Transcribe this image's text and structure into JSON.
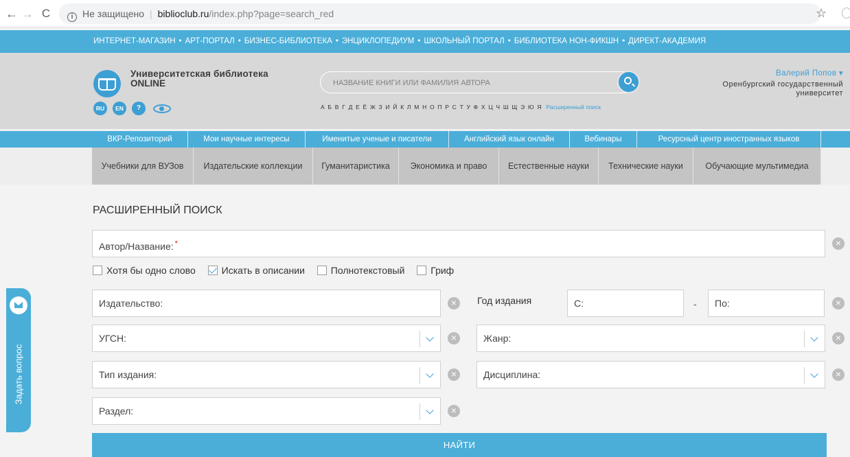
{
  "browser": {
    "insecure_label": "Не защищено",
    "url_host": "biblioclub.ru",
    "url_path": "/index.php?page=search_red"
  },
  "portals": [
    "ИНТЕРНЕТ-МАГАЗИН",
    "АРТ-ПОРТАЛ",
    "БИЗНЕС-БИБЛИОТЕКА",
    "ЭНЦИКЛОПЕДИУМ",
    "ШКОЛЬНЫЙ ПОРТАЛ",
    "БИБЛИОТЕКА НОН-ФИКШН",
    "ДИРЕКТ-АКАДЕМИЯ"
  ],
  "portal_separator": "•",
  "header": {
    "logo_title": "Университетская библиотека",
    "logo_sub": "ONLINE",
    "lang_ru": "RU",
    "lang_en": "EN",
    "help": "?",
    "search_placeholder": "НАЗВАНИЕ КНИГИ ИЛИ ФАМИЛИЯ АВТОРА",
    "alphabet": "А Б В Г Д Е Ё Ж З И Й К Л М Н О П Р С Т У Ф Х Ц Ч Ш Щ Э Ю Я",
    "advanced_link": "Расширенный поиск",
    "user_name": "Валерий Попов ▾",
    "user_org": "Оренбургский государственный университет"
  },
  "nav1": [
    "ВКР-Репозиторий",
    "Мои научные интересы",
    "Именитые ученые и писатели",
    "Английский язык онлайн",
    "Вебинары",
    "Ресурсный центр иностранных языков"
  ],
  "nav2": [
    "Учебники для ВУЗов",
    "Издательские коллекции",
    "Гуманитаристика",
    "Экономика и право",
    "Естественные науки",
    "Технические науки",
    "Обучающие мультимедиа"
  ],
  "form": {
    "title": "РАСШИРЕННЫЙ ПОИСК",
    "author_title_label": "Автор/Название:",
    "required_mark": "*",
    "checkboxes": [
      {
        "label": "Хотя бы одно слово",
        "checked": false
      },
      {
        "label": "Искать в описании",
        "checked": true
      },
      {
        "label": "Полнотекстовый",
        "checked": false
      },
      {
        "label": "Гриф",
        "checked": false
      }
    ],
    "publisher_label": "Издательство:",
    "year_label": "Год издания",
    "year_from": "С:",
    "year_dash": "-",
    "year_to": "По:",
    "ugsn_label": "УГСН:",
    "genre_label": "Жанр:",
    "edition_type_label": "Тип издания:",
    "discipline_label": "Дисциплина:",
    "section_label": "Раздел:",
    "clear_symbol": "×",
    "find_button": "НАЙТИ"
  },
  "ask_tab": "Задать вопрос"
}
